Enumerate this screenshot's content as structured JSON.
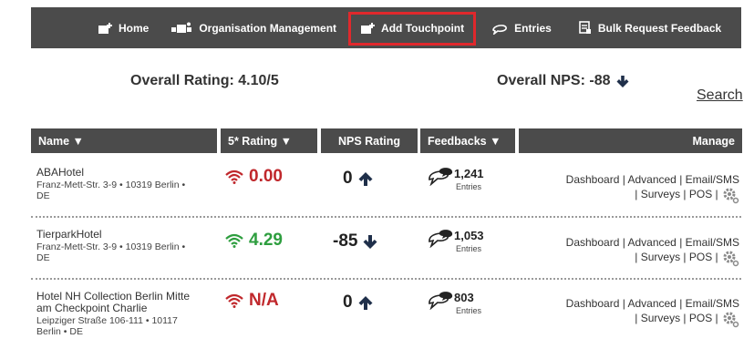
{
  "nav": {
    "home": "Home",
    "org": "Organisation Management",
    "add": "Add Touchpoint",
    "entries": "Entries",
    "bulk": "Bulk Request Feedback"
  },
  "summary": {
    "overall_rating": "Overall Rating: 4.10/5",
    "overall_nps": "Overall NPS: -88",
    "search": "Search"
  },
  "table": {
    "headers": {
      "name": "Name ▼",
      "rating": "5* Rating ▼",
      "nps": "NPS Rating",
      "feedbacks": "Feedbacks ▼",
      "manage": "Manage"
    },
    "rows": [
      {
        "name": "ABAHotel",
        "addr1": "Franz-Mett-Str. 3-9 • 10319 Berlin •",
        "addr2": "DE",
        "rating": "0.00",
        "nps": "0",
        "feedbacks": "1,241",
        "entries": "Entries",
        "manage1": "Dashboard |  Advanced  | Email/SMS",
        "manage2": "| Surveys  | POS  |"
      },
      {
        "name": "TierparkHotel",
        "addr1": "Franz-Mett-Str. 3-9 • 10319 Berlin •",
        "addr2": "DE",
        "rating": "4.29",
        "nps": "-85",
        "feedbacks": "1,053",
        "entries": "Entries",
        "manage1": "Dashboard |  Advanced  | Email/SMS",
        "manage2": "| Surveys  | POS  |"
      },
      {
        "name": "Hotel NH Collection Berlin Mitte",
        "name2": "am Checkpoint Charlie",
        "addr1": "Leipziger Straße 106-111 • 10117",
        "addr2": "Berlin • DE",
        "rating": "N/A",
        "nps": "0",
        "feedbacks": "803",
        "entries": "Entries",
        "manage1": "Dashboard |  Advanced  | Email/SMS",
        "manage2": "| Surveys  | POS  |"
      }
    ]
  },
  "colors": {
    "nav_bg": "#4b4b4b",
    "highlight": "#e0282c",
    "rating_red": "#c0282c",
    "rating_green": "#2e9e3f"
  }
}
